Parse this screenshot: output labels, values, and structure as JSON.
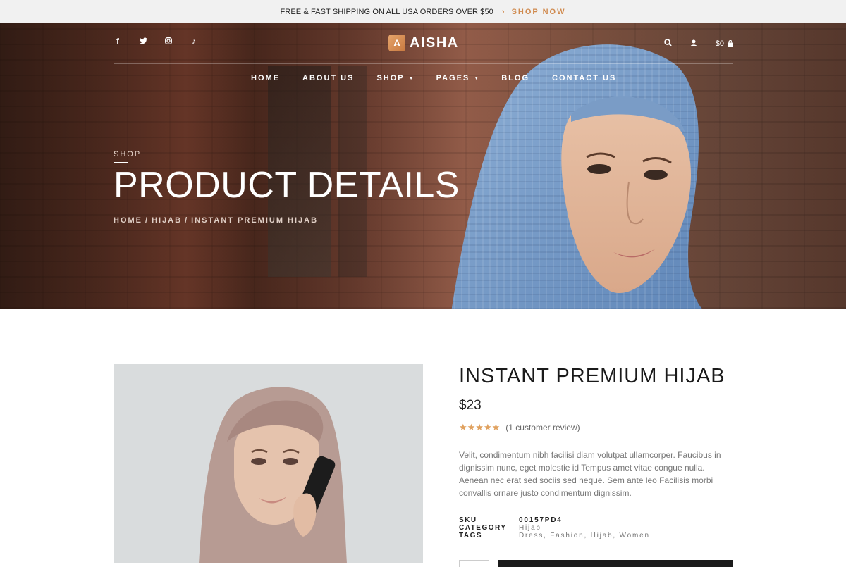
{
  "announcement": {
    "message": "FREE & FAST SHIPPING ON ALL USA ORDERS OVER $50",
    "cta_icon": "chevron-right-icon",
    "cta_label": "SHOP NOW",
    "cta_color": "#d08a4e"
  },
  "header": {
    "social": [
      "facebook-icon",
      "twitter-icon",
      "instagram-icon",
      "tiktok-icon"
    ],
    "social_glyphs": [
      "f",
      "🐦",
      "◎",
      "♪"
    ],
    "brand": {
      "mark": "A",
      "name": "AISHA"
    },
    "cart_total": "$0",
    "menu": [
      {
        "label": "HOME",
        "dropdown": false
      },
      {
        "label": "ABOUT US",
        "dropdown": false
      },
      {
        "label": "SHOP",
        "dropdown": true
      },
      {
        "label": "PAGES",
        "dropdown": true
      },
      {
        "label": "BLOG",
        "dropdown": false
      },
      {
        "label": "CONTACT US",
        "dropdown": false
      }
    ]
  },
  "hero": {
    "eyebrow": "SHOP",
    "title": "PRODUCT DETAILS",
    "breadcrumb": [
      "HOME",
      "HIJAB",
      "INSTANT PREMIUM HIJAB"
    ],
    "separator": "/"
  },
  "product": {
    "title": "INSTANT PREMIUM HIJAB",
    "price": "$23",
    "rating": 5,
    "stars": "★★★★★",
    "review_text": "(1 customer review)",
    "description": "Velit, condimentum nibh facilisi diam volutpat ullamcorper. Faucibus in dignissim nunc, eget molestie id Tempus amet vitae congue nulla. Aenean nec erat sed sociis sed neque. Sem ante leo Facilisis morbi convallis ornare justo condimentum dignissim.",
    "meta": {
      "sku_label": "SKU",
      "sku": "00157PD4",
      "category_label": "CATEGORY",
      "category": "Hijab",
      "tags_label": "TAGS",
      "tags": "Dress, Fashion, Hijab, Women"
    }
  },
  "colors": {
    "accent": "#d08a4e",
    "star": "#e0a15f",
    "dark": "#1b1b1b"
  }
}
